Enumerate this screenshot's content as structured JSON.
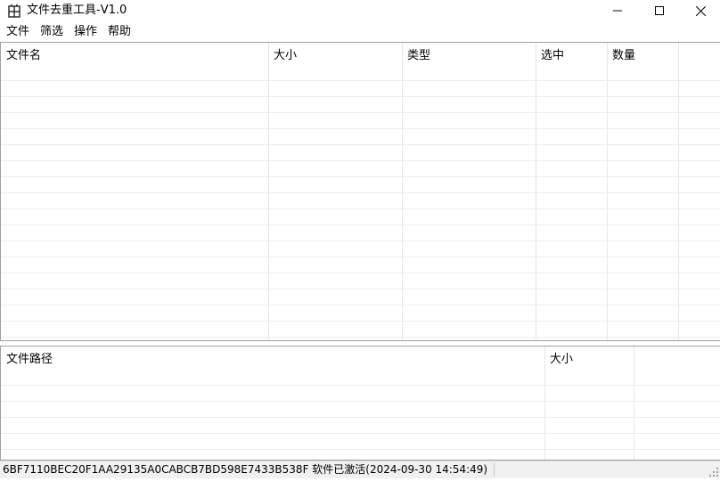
{
  "window": {
    "title": "文件去重工具-V1.0"
  },
  "menu": [
    "文件",
    "筛选",
    "操作",
    "帮助"
  ],
  "file_table": {
    "columns": [
      "文件名",
      "大小",
      "类型",
      "选中",
      "数量"
    ],
    "rows": []
  },
  "path_table": {
    "columns": [
      "文件路径",
      "大小"
    ],
    "rows": []
  },
  "status": {
    "text": "6BF7110BEC20F1AA29135A0CABCB7BD598E7433B538F 软件已激活(2024-09-30 14:54:49)"
  },
  "icons": {
    "app": "app-icon",
    "minimize": "minimize-icon",
    "maximize": "maximize-icon",
    "close": "close-icon",
    "grip": "resize-grip-icon"
  }
}
